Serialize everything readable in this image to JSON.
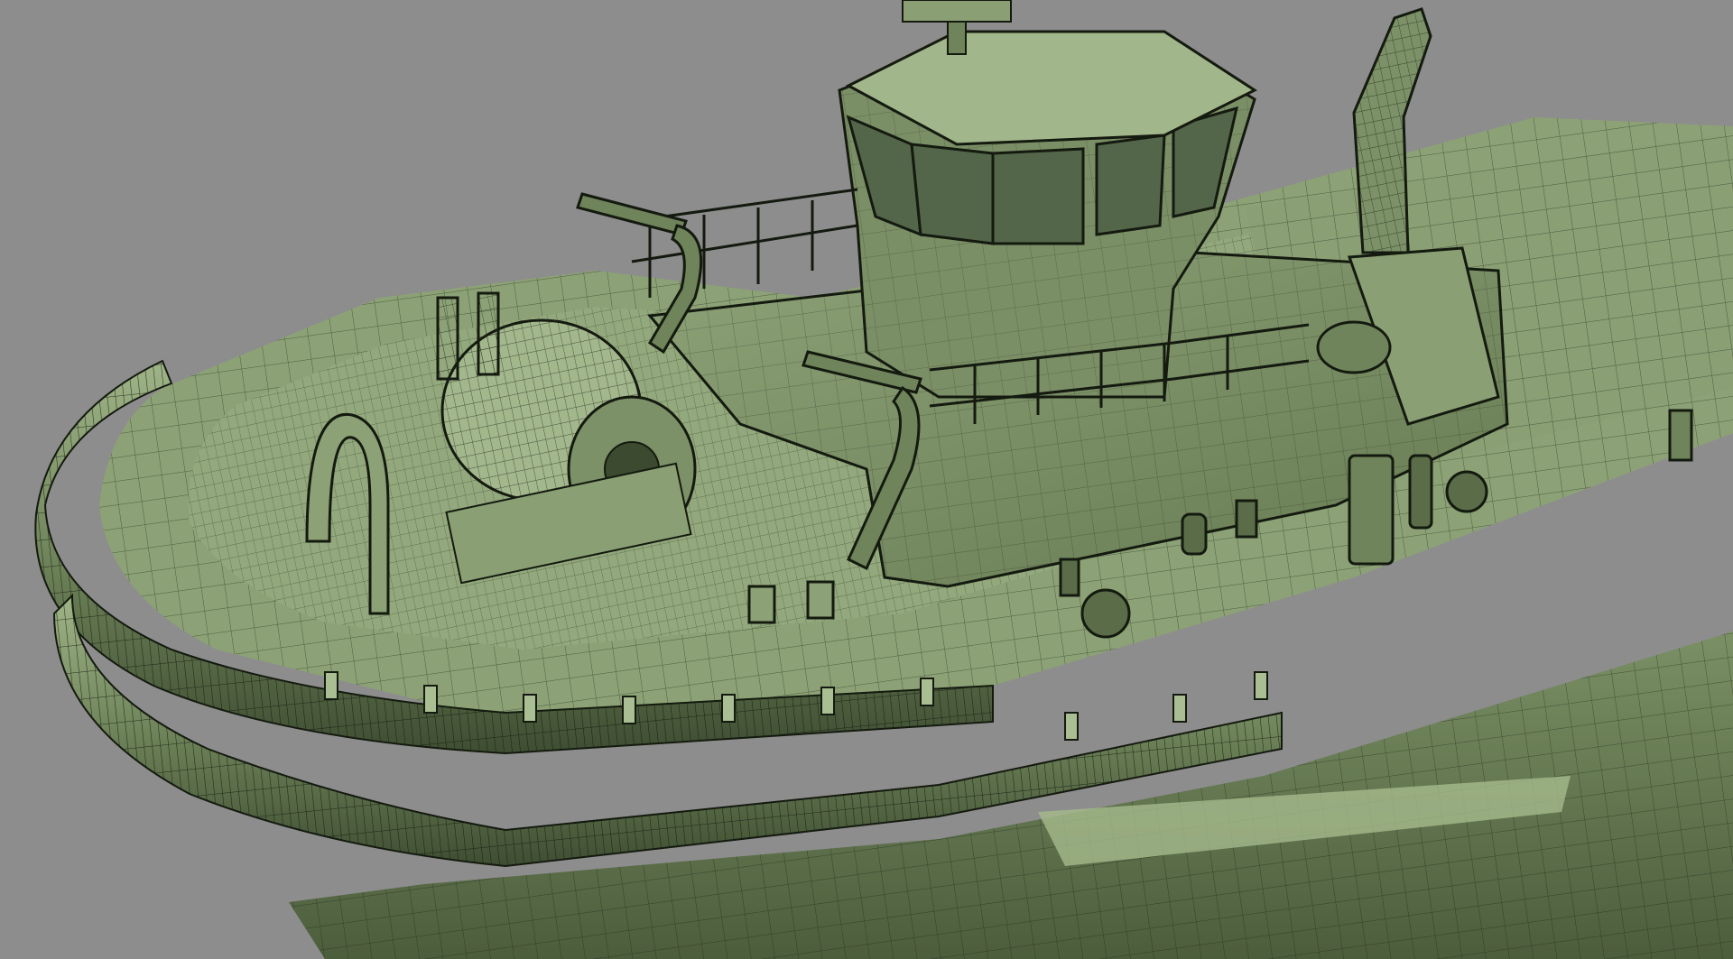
{
  "viewport": {
    "background_color": "#8d8d8d"
  },
  "model": {
    "shading": "wireframe-on-shaded",
    "surface_color": "#7f9468",
    "surface_light_color": "#a9be92",
    "surface_dark_color": "#3c4a30",
    "wire_color": "#1b2214"
  }
}
